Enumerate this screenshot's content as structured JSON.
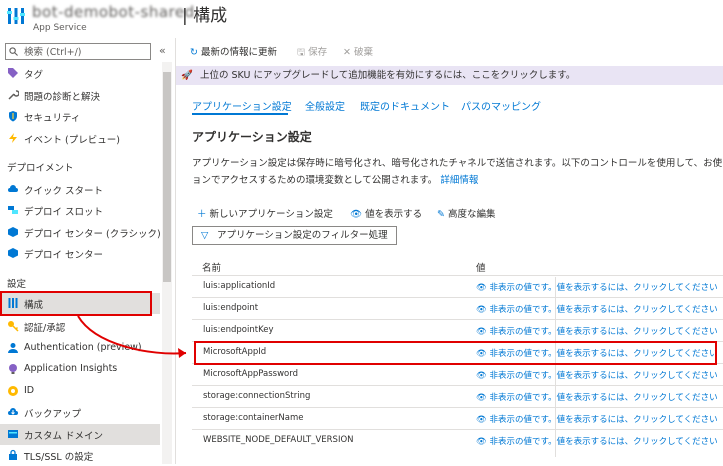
{
  "header": {
    "app_name": "bot-demobot-shared",
    "separator_title": "| 構成",
    "app_type": "App Service"
  },
  "sidebar": {
    "search_placeholder": "検索 (Ctrl+/)",
    "items_top": [
      {
        "label": "タグ",
        "icon": "tag-icon"
      },
      {
        "label": "問題の診断と解決",
        "icon": "wrench-icon"
      },
      {
        "label": "セキュリティ",
        "icon": "shield-icon"
      },
      {
        "label": "イベント (プレビュー)",
        "icon": "lightning-icon"
      }
    ],
    "section_deploy": "デプロイメント",
    "items_deploy": [
      {
        "label": "クイック スタート",
        "icon": "cloud-icon"
      },
      {
        "label": "デプロイ スロット",
        "icon": "slots-icon"
      },
      {
        "label": "デプロイ センター (クラシック)",
        "icon": "cube-icon"
      },
      {
        "label": "デプロイ センター",
        "icon": "cube-icon"
      }
    ],
    "section_settings": "設定",
    "items_settings": [
      {
        "label": "構成",
        "icon": "config-icon",
        "selected": true
      },
      {
        "label": "認証/承認",
        "icon": "key-icon"
      },
      {
        "label": "Authentication (preview)",
        "icon": "person-icon"
      },
      {
        "label": "Application Insights",
        "icon": "bulb-icon"
      },
      {
        "label": "ID",
        "icon": "identity-icon"
      },
      {
        "label": "バックアップ",
        "icon": "backup-icon"
      },
      {
        "label": "カスタム ドメイン",
        "icon": "domain-icon",
        "highlight": true
      },
      {
        "label": "TLS/SSL の設定",
        "icon": "lock-icon"
      }
    ]
  },
  "toolbar": {
    "refresh": "最新の情報に更新",
    "save": "保存",
    "discard": "破棄"
  },
  "banner": "上位の SKU にアップグレードして追加機能を有効にするには、ここをクリックします。",
  "tabs": [
    "アプリケーション設定",
    "全般設定",
    "既定のドキュメント",
    "パスのマッピング"
  ],
  "section_title": "アプリケーション設定",
  "description": {
    "line1": "アプリケーション設定は保存時に暗号化され、暗号化されたチャネルで送信されます。以下のコントロールを使用して、お使いのアプリケーションにおける実行時に環境変数としてアクセスするための環境変数として公開されます。",
    "line2": "ョンでアクセスするための環境変数として公開されます。",
    "link": "詳細情報"
  },
  "actions": {
    "new": "新しいアプリケーション設定",
    "show": "値を表示する",
    "advanced": "高度な編集"
  },
  "filter_label": "アプリケーション設定のフィルター処理",
  "table": {
    "col_name": "名前",
    "col_value": "値",
    "hidden_value": "非表示の値です。値を表示するには、クリックしてください",
    "rows": [
      "luis:applicationId",
      "luis:endpoint",
      "luis:endpointKey",
      "MicrosoftAppId",
      "MicrosoftAppPassword",
      "storage:connectionString",
      "storage:containerName",
      "WEBSITE_NODE_DEFAULT_VERSION"
    ]
  },
  "colors": {
    "accent": "#0078d4",
    "annotation_red": "#e00000",
    "banner_bg": "#e9e4f4"
  }
}
